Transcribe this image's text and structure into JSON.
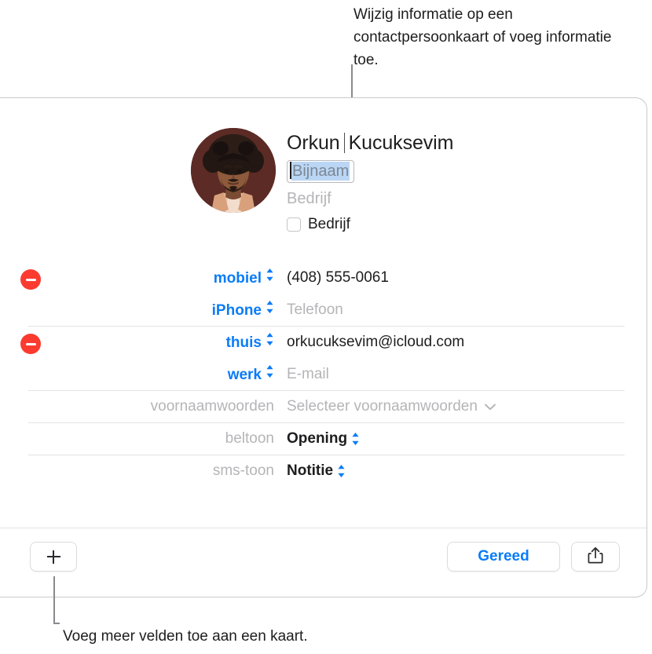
{
  "callouts": {
    "top": "Wijzig informatie op een contactpersoonkaart of voeg informatie toe.",
    "bottom": "Voeg meer velden toe aan een kaart."
  },
  "colors": {
    "accent_blue": "#0a7cf8",
    "delete_red": "#fc3b30",
    "selection_blue": "#bad6f4",
    "placeholder_grey": "#b5b5b8",
    "divider": "#e3e3e4",
    "avatar_bg": "#5c2b25"
  },
  "contact_card": {
    "avatar": {
      "icon": "contact-photo-avatar",
      "alt": "Profielfoto"
    },
    "first_name": "Orkun",
    "last_name": "Kucuksevim",
    "nickname_field": {
      "placeholder": "Bijnaam",
      "selected": true,
      "has_caret": true
    },
    "company_field": {
      "placeholder": "Bedrijf"
    },
    "company_checkbox": {
      "label": "Bedrijf",
      "checked": false
    },
    "fields": [
      {
        "deletable": true,
        "label": "mobiel",
        "label_style": "link",
        "control": "stepper",
        "value": "(408) 555-0061",
        "value_style": "filled",
        "divider": false
      },
      {
        "deletable": false,
        "label": "iPhone",
        "label_style": "link",
        "control": "stepper",
        "value": "Telefoon",
        "value_style": "placeholder",
        "divider": false
      },
      {
        "deletable": true,
        "label": "thuis",
        "label_style": "link",
        "control": "stepper",
        "value": "orkucuksevim@icloud.com",
        "value_style": "filled",
        "divider": true
      },
      {
        "deletable": false,
        "label": "werk",
        "label_style": "link",
        "control": "stepper",
        "value": "E-mail",
        "value_style": "placeholder",
        "divider": false
      },
      {
        "deletable": false,
        "label": "voornaamwoorden",
        "label_style": "muted",
        "control": "chevron-down",
        "value": "Selecteer voornaamwoorden",
        "value_style": "placeholder",
        "divider": true
      },
      {
        "deletable": false,
        "label": "beltoon",
        "label_style": "muted",
        "control": "stepper",
        "value": "Opening",
        "value_style": "bold",
        "divider": true
      },
      {
        "deletable": false,
        "label": "sms-toon",
        "label_style": "muted",
        "control": "stepper",
        "value": "Notitie",
        "value_style": "bold",
        "divider": true
      }
    ]
  },
  "toolbar": {
    "add_field_button": {
      "icon": "plus-icon",
      "label": ""
    },
    "done_button": {
      "label": "Gereed"
    },
    "share_button": {
      "icon": "share-icon",
      "label": ""
    }
  }
}
